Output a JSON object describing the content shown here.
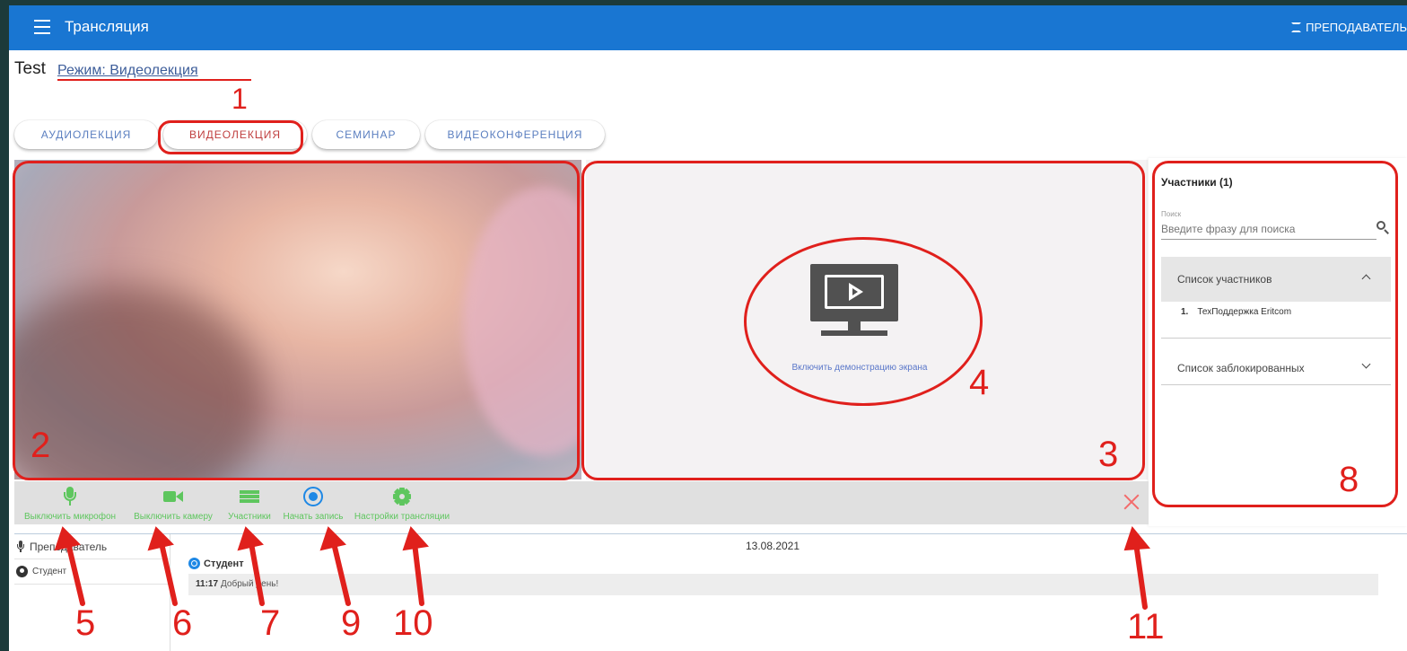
{
  "appbar": {
    "title": "Трансляция",
    "role": "ПРЕПОДАВАТЕЛЬ"
  },
  "header": {
    "title": "Test",
    "mode": "Режим: Видеолекция"
  },
  "tabs": [
    {
      "label": "АУДИОЛЕКЦИЯ"
    },
    {
      "label": "ВИДЕОЛЕКЦИЯ"
    },
    {
      "label": "СЕМИНАР"
    },
    {
      "label": "ВИДЕОКОНФЕРЕНЦИЯ"
    }
  ],
  "screen_share": {
    "label": "Включить демонстрацию экрана",
    "icon": "screen-share-icon"
  },
  "participants": {
    "title": "Участники (1)",
    "search_label": "Поиск",
    "search_placeholder": "Введите фразу для поиска",
    "list_header": "Список участников",
    "members": [
      {
        "index": "1.",
        "name": "ТехПоддержка Eritcom"
      }
    ],
    "blocked_header": "Список заблокированных"
  },
  "toolbar": {
    "mic": "Выключить микрофон",
    "camera": "Выключить камеру",
    "participants": "Участники",
    "record": "Начать запись",
    "settings": "Настройки трансляции"
  },
  "bottom": {
    "sidebar": [
      {
        "label": "Преподаватель"
      },
      {
        "label": "Студент"
      }
    ],
    "chat": {
      "date": "13.08.2021",
      "author": "Студент",
      "time": "11:17",
      "text": "Добрый день!"
    }
  },
  "annotations": [
    "1",
    "2",
    "3",
    "4",
    "5",
    "6",
    "7",
    "8",
    "9",
    "10",
    "11"
  ],
  "colors": {
    "appbar": "#1976d2",
    "annotation": "#e0201c",
    "toolbar_icon": "#5ec65e",
    "record_icon": "#1e88e5"
  }
}
